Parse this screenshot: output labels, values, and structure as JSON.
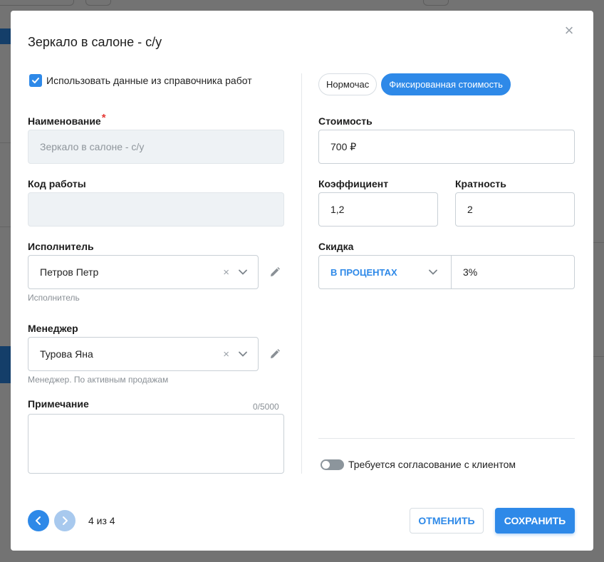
{
  "modal": {
    "title": "Зеркало в салоне - с/у",
    "use_directory_label": "Использовать данные из справочника работ",
    "use_directory_checked": true
  },
  "left": {
    "name_label": "Наименование",
    "name_required_mark": "*",
    "name_value": "Зеркало в салоне - с/у",
    "code_label": "Код работы",
    "code_value": "",
    "executor_label": "Исполнитель",
    "executor_value": "Петров Петр",
    "executor_hint": "Исполнитель",
    "manager_label": "Менеджер",
    "manager_value": "Турова Яна",
    "manager_hint": "Менеджер. По активным продажам",
    "note_label": "Примечание",
    "note_counter": "0/5000",
    "note_value": ""
  },
  "right": {
    "pricing_modes": [
      "Нормочас",
      "Фиксированная стоимость"
    ],
    "active_mode": "Фиксированная стоимость",
    "cost_label": "Стоимость",
    "cost_value": "700 ₽",
    "coef_label": "Коэффициент",
    "coef_value": "1,2",
    "multiplicity_label": "Кратность",
    "multiplicity_value": "2",
    "discount_label": "Скидка",
    "discount_type": "В ПРОЦЕНТАХ",
    "discount_value": "3%",
    "approval_label": "Требуется согласование с клиентом",
    "approval_on": false
  },
  "footer": {
    "pager": "4 из 4",
    "cancel_label": "ОТМЕНИТЬ",
    "save_label": "СОХРАНИТЬ"
  },
  "colors": {
    "accent": "#2e89e8",
    "required": "#e53935",
    "disabled_bg": "#eef2f5"
  },
  "icons": [
    "checkmark-icon",
    "close-icon",
    "clear-icon",
    "chevron-down-icon",
    "pencil-icon",
    "chevron-left-icon",
    "chevron-right-icon"
  ]
}
